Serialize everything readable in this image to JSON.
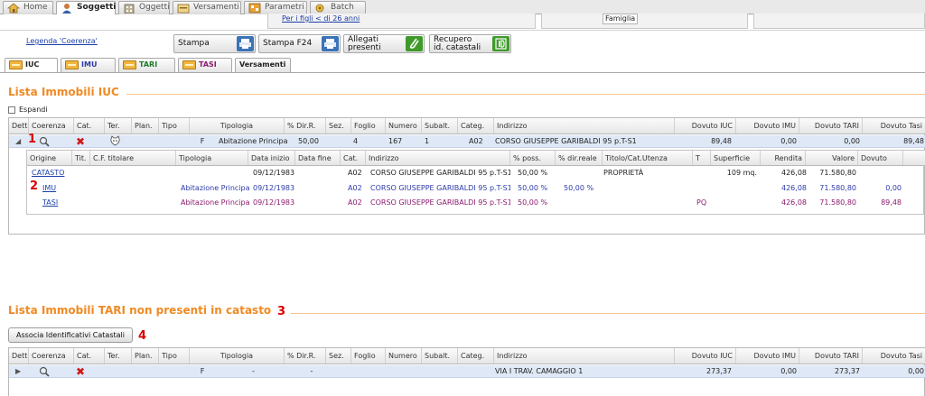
{
  "nav": {
    "tabs": [
      {
        "label": "Home"
      },
      {
        "label": "Soggetti"
      },
      {
        "label": "Oggetti"
      },
      {
        "label": "Versamenti"
      },
      {
        "label": "Parametri"
      },
      {
        "label": "Batch"
      }
    ],
    "sub_link": "Per i figli < di 26 anni",
    "sub_famiglia": "Famiglia"
  },
  "toolbar": {
    "legend_link": "Legenda 'Coerenza'",
    "stampa": "Stampa",
    "stampa_f24": "Stampa F24",
    "allegati_line1": "Allegati",
    "allegati_line2": "presenti",
    "recupero_line1": "Recupero",
    "recupero_line2": "id. catastali"
  },
  "subtabs": [
    {
      "label": "IUC",
      "color": "#222222"
    },
    {
      "label": "IMU",
      "color": "#2d3aa8"
    },
    {
      "label": "TARI",
      "color": "#1c7a2a"
    },
    {
      "label": "TASI",
      "color": "#8a1a6e"
    },
    {
      "label": "Versamenti",
      "color": "#222222"
    }
  ],
  "section1": {
    "title": "Lista Immobili IUC",
    "espandi": "Espandi",
    "headers": [
      "Dett.",
      "Coerenza",
      "Cat.",
      "Ter.",
      "Plan.",
      "Tipo",
      "Tipologia",
      "% Dir.R.",
      "Sez.",
      "Foglio",
      "Numero",
      "Subalt.",
      "Categ.",
      "Indirizzo",
      "Dovuto IUC",
      "Dovuto IMU",
      "Dovuto TARI",
      "Dovuto Tasi"
    ],
    "row": {
      "tipo": "F",
      "tipologia": "Abitazione Principale",
      "dir": "50,00",
      "foglio": "4",
      "numero": "167",
      "subalt": "1",
      "categ": "A02",
      "indirizzo": "CORSO GIUSEPPE GARIBALDI 95 p.T-S1",
      "dovuto_iuc": "89,48",
      "dovuto_imu": "0,00",
      "dovuto_tari": "0,00",
      "dovuto_tasi": "89,48"
    },
    "detail_headers": [
      "Origine",
      "Tit.",
      "C.F. titolare",
      "Tipologia",
      "Data inizio",
      "Data fine",
      "Cat.",
      "Indirizzo",
      "% poss.",
      "% dir.reale",
      "Titolo/Cat.Utenza",
      "T",
      "Superficie",
      "Rendita",
      "Valore",
      "Dovuto"
    ],
    "detail_rows": [
      {
        "origine": "CATASTO",
        "tipologia": "",
        "data_inizio": "09/12/1983",
        "cat": "A02",
        "indirizzo": "CORSO GIUSEPPE GARIBALDI 95 p.T-S1",
        "poss": "50,00 %",
        "dir": "",
        "titolo": "PROPRIETÀ",
        "t": "",
        "superficie": "109 mq.",
        "rendita": "426,08",
        "valore": "71.580,80",
        "dovuto": "",
        "color": "#222222"
      },
      {
        "origine": "IMU",
        "tipologia": "Abitazione Principale",
        "data_inizio": "09/12/1983",
        "cat": "A02",
        "indirizzo": "CORSO GIUSEPPE GARIBALDI 95 p.T-S1",
        "poss": "50,00 %",
        "dir": "50,00 %",
        "titolo": "",
        "t": "",
        "superficie": "",
        "rendita": "426,08",
        "valore": "71.580,80",
        "dovuto": "0,00",
        "color": "#2d3aa8"
      },
      {
        "origine": "TASI",
        "tipologia": "Abitazione Principale",
        "data_inizio": "09/12/1983",
        "cat": "A02",
        "indirizzo": "CORSO GIUSEPPE GARIBALDI 95 p.T-S1",
        "poss": "50,00 %",
        "dir": "",
        "titolo": "",
        "t": "PQ",
        "superficie": "",
        "rendita": "426,08",
        "valore": "71.580,80",
        "dovuto": "89,48",
        "color": "#8a1a6e"
      }
    ]
  },
  "section2": {
    "title": "Lista Immobili TARI non presenti in catasto",
    "button": "Associa Identificativi Catastali",
    "headers": [
      "Dett.",
      "Coerenza",
      "Cat.",
      "Ter.",
      "Plan.",
      "Tipo",
      "Tipologia",
      "% Dir.R.",
      "Sez.",
      "Foglio",
      "Numero",
      "Subalt.",
      "Categ.",
      "Indirizzo",
      "Dovuto IUC",
      "Dovuto IMU",
      "Dovuto TARI",
      "Dovuto Tasi"
    ],
    "row": {
      "tipo": "F",
      "tipologia": "-",
      "dir": "-",
      "indirizzo": "VIA I TRAV. CAMAGGIO 1",
      "dovuto_iuc": "273,37",
      "dovuto_imu": "0,00",
      "dovuto_tari": "273,37",
      "dovuto_tasi": "0,00"
    }
  },
  "markers": [
    "1",
    "2",
    "3",
    "4"
  ],
  "colors": {
    "accent": "#f08a24",
    "marker": "#d80000",
    "link": "#1a3fa8",
    "selected_row": "#dfe8f6"
  }
}
